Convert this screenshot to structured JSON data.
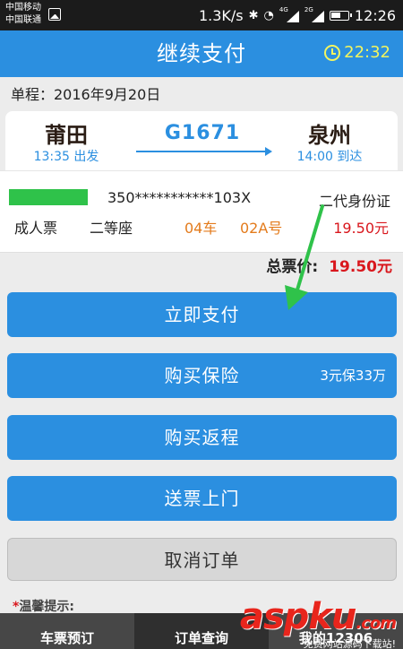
{
  "status_bar": {
    "carrier_1": "中国移动",
    "carrier_2": "中国联通",
    "speed": "1.3K/s",
    "bluetooth": "✱",
    "wifi": "◔",
    "net1": "4G",
    "net2": "2G",
    "time": "12:26"
  },
  "header": {
    "title": "继续支付",
    "countdown": "22:32"
  },
  "trip": {
    "date_label": "单程：2016年9月20日",
    "from_station": "莆田",
    "depart_time": "13:35 出发",
    "train_no": "G1671",
    "to_station": "泉州",
    "arrive_time": "14:00 到达"
  },
  "passenger": {
    "id_number": "350***********103X",
    "id_type": "二代身份证",
    "ticket_type": "成人票",
    "seat_class": "二等座",
    "car": "04车",
    "seat_no": "02A号",
    "price": "19.50元"
  },
  "total": {
    "label": "总票价:",
    "value": "19.50元"
  },
  "buttons": {
    "pay": "立即支付",
    "insurance": "购买保险",
    "insurance_note": "3元保33万",
    "return_ticket": "购买返程",
    "delivery": "送票上门",
    "cancel": "取消订单"
  },
  "tips": {
    "star": "*",
    "label": "温馨提示:"
  },
  "tabs": [
    "车票预订",
    "订单查询",
    "我的12306"
  ],
  "watermark": {
    "logo": "aspku",
    "dot": ".com",
    "sub": "免费网站源码下载站!"
  },
  "colors": {
    "primary": "#2b8fe0",
    "accent_green": "#2fc24a",
    "price_red": "#d9171d",
    "seat_orange": "#e37b1c",
    "timer_yellow": "#f3f55f"
  }
}
